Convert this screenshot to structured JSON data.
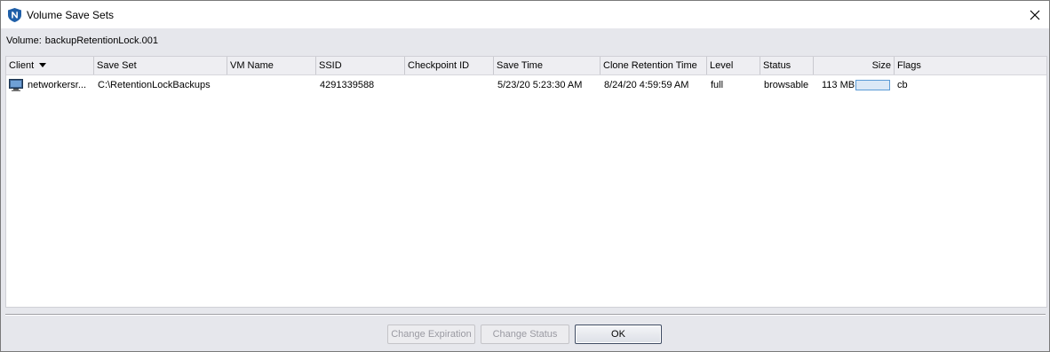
{
  "window": {
    "title": "Volume Save Sets",
    "app_icon": "networker-shield-icon"
  },
  "volume": {
    "label": "Volume:",
    "value": "backupRetentionLock.001"
  },
  "table": {
    "columns": {
      "client": "Client",
      "save_set": "Save Set",
      "vm_name": "VM Name",
      "ssid": "SSID",
      "checkpoint_id": "Checkpoint ID",
      "save_time": "Save Time",
      "clone_retention_time": "Clone Retention Time",
      "level": "Level",
      "status": "Status",
      "size": "Size",
      "flags": "Flags"
    },
    "sort_column": "Client",
    "rows": [
      {
        "client": "networkersr...",
        "save_set": "C:\\RetentionLockBackups",
        "vm_name": "",
        "ssid": "4291339588",
        "checkpoint_id": "",
        "save_time": "5/23/20 5:23:30 AM",
        "clone_retention_time": "8/24/20 4:59:59 AM",
        "level": "full",
        "status": "browsable",
        "size": "113 MB",
        "flags": "cb"
      }
    ]
  },
  "buttons": {
    "change_expiration": "Change Expiration",
    "change_status": "Change Status",
    "ok": "OK"
  },
  "colors": {
    "accent": "#1f5fa8",
    "size_bar_border": "#5b9bd5"
  }
}
